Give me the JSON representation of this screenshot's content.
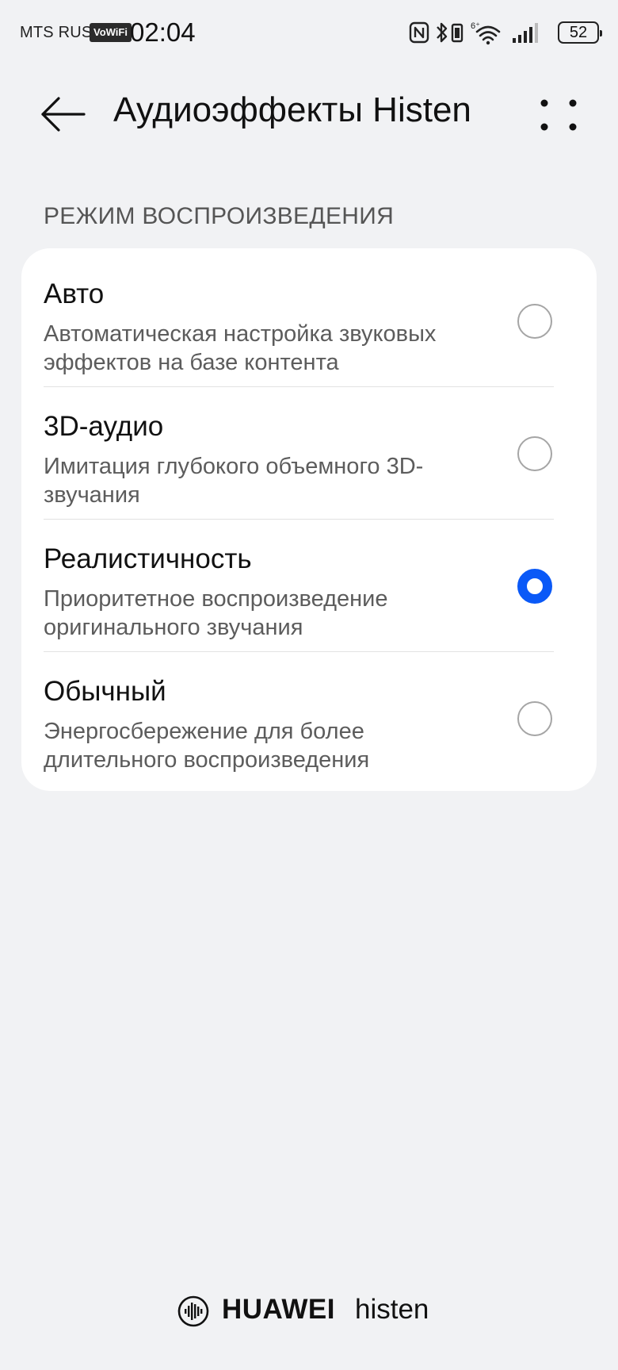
{
  "status_bar": {
    "carrier": "MTS RUS",
    "vowifi_badge": "VoWiFi",
    "time": "02:04",
    "battery_level": "52",
    "icons": [
      "nfc-icon",
      "bluetooth-icon",
      "vibrate-icon",
      "wifi-6-icon",
      "signal-icon",
      "battery-icon"
    ]
  },
  "header": {
    "title": "Аудиоэффекты Histen"
  },
  "section": {
    "title": "РЕЖИМ ВОСПРОИЗВЕДЕНИЯ"
  },
  "options": [
    {
      "title": "Авто",
      "description": "Автоматическая настройка звуковых эффектов на базе контента",
      "selected": false
    },
    {
      "title": "3D-аудио",
      "description": "Имитация глубокого объемного 3D-звучания",
      "selected": false
    },
    {
      "title": "Реалистичность",
      "description": "Приоритетное воспроизведение оригинального звучания",
      "selected": true
    },
    {
      "title": "Обычный",
      "description": "Энергосбережение для более длительного воспроизведения",
      "selected": false
    }
  ],
  "footer": {
    "brand_primary": "HUAWEI",
    "brand_secondary": "histen"
  },
  "colors": {
    "background": "#f1f2f4",
    "card": "#ffffff",
    "accent": "#0a59f7",
    "secondary_text": "#5c5c5c"
  }
}
